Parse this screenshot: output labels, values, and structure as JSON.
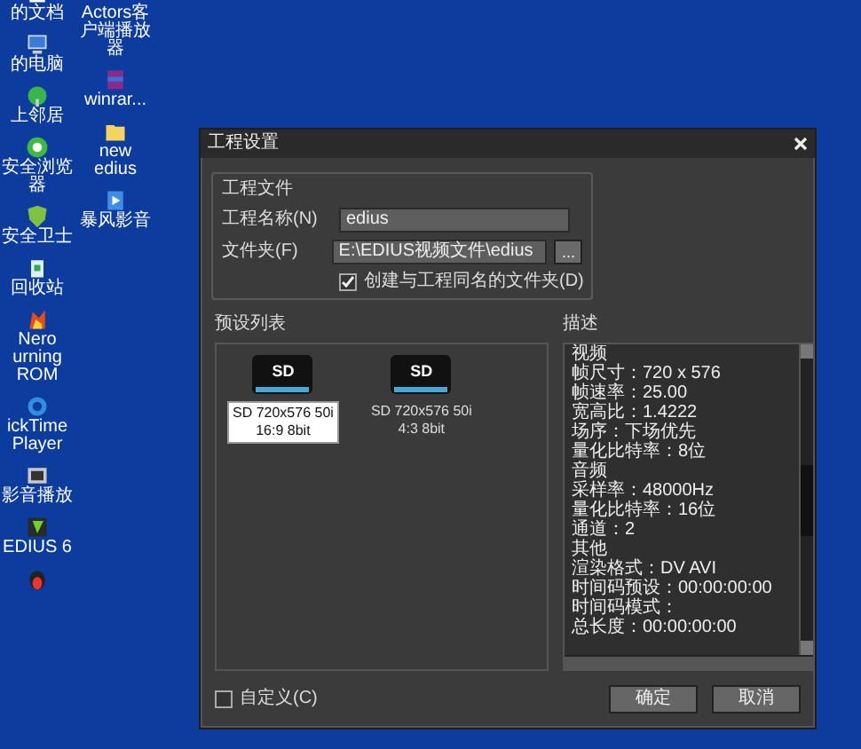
{
  "desktop": {
    "columns": [
      {
        "icons": [
          {
            "kind": "documents",
            "label": "的文档"
          },
          {
            "kind": "computer",
            "label": "的电脑"
          },
          {
            "kind": "network",
            "label": "上邻居"
          },
          {
            "kind": "browser",
            "label": "安全浏览器"
          },
          {
            "kind": "shield",
            "label": "安全卫士"
          },
          {
            "kind": "recycle",
            "label": "回收站"
          },
          {
            "kind": "flame",
            "label": "Nero\nurning ROM"
          },
          {
            "kind": "quicktime",
            "label": "ickTime\nPlayer"
          },
          {
            "kind": "player",
            "label": "影音播放"
          },
          {
            "kind": "edius",
            "label": "EDIUS 6"
          },
          {
            "kind": "penguin"
          }
        ]
      },
      {
        "icons": [
          {
            "kind": "none",
            "label": "Actors客户端播放器"
          },
          {
            "kind": "archive",
            "label": "winrar..."
          },
          {
            "kind": "folder",
            "label": "new edius"
          },
          {
            "kind": "video",
            "label": "暴风影音"
          }
        ]
      }
    ]
  },
  "dialog": {
    "title": "工程设置",
    "project_file": {
      "legend": "工程文件",
      "name_label": "工程名称(N)",
      "name_value": "edius",
      "folder_label": "文件夹(F)",
      "folder_value": "E:\\EDIUS视频文件\\edius",
      "browse": "...",
      "create_folder": {
        "label": "创建与工程同名的文件夹(D)",
        "checked": true
      }
    },
    "presets": {
      "heading": "预设列表",
      "items": [
        {
          "badge": "SD",
          "line1": "SD 720x576 50i",
          "line2": "16:9 8bit",
          "selected": true
        },
        {
          "badge": "SD",
          "line1": "SD 720x576 50i",
          "line2": "4:3 8bit",
          "selected": false
        }
      ]
    },
    "description": {
      "heading": "描述",
      "lines": [
        "视频",
        "帧尺寸：720 x 576",
        "帧速率：25.00",
        "宽高比：1.4222",
        "场序：下场优先",
        "量化比特率：8位",
        "音频",
        "采样率：48000Hz",
        "量化比特率：16位",
        "通道：2",
        "其他",
        "渲染格式：DV AVI",
        "时间码预设：00:00:00:00",
        "时间码模式：",
        "总长度：00:00:00:00"
      ]
    },
    "custom": {
      "label": "自定义(C)",
      "checked": false
    },
    "buttons": [
      "确定",
      "取消"
    ]
  }
}
